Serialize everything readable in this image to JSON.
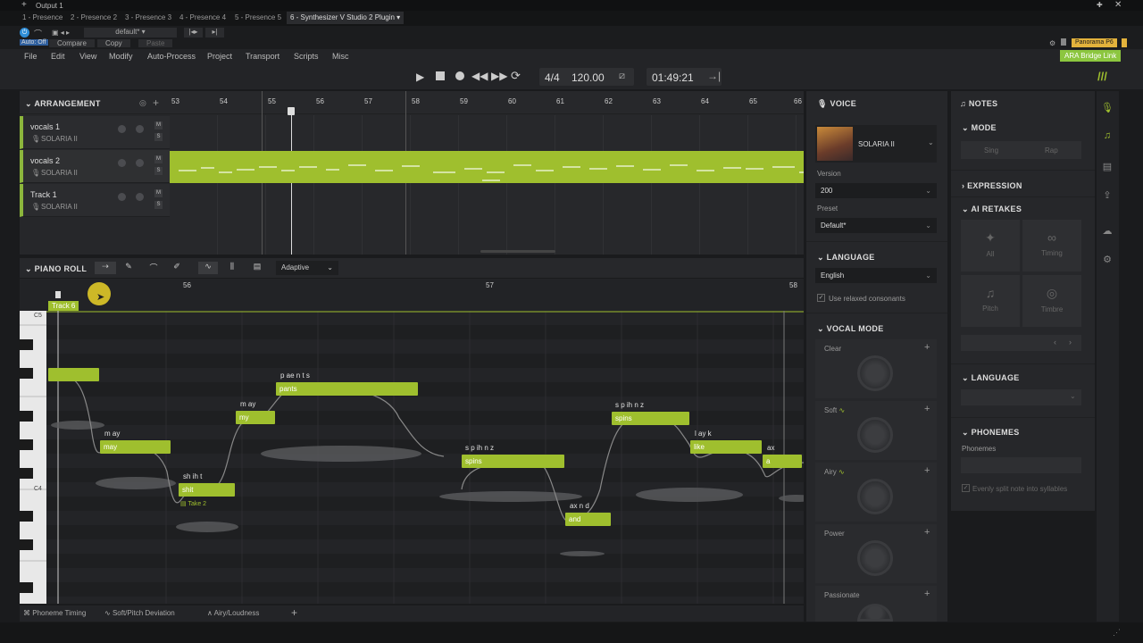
{
  "window": {
    "title": "Output 1"
  },
  "tabs": [
    "1 - Presence",
    "2 - Presence 2",
    "3 - Presence 3",
    "4 - Presence 4",
    "5 - Presence 5",
    "6 - Synthesizer V Studio 2 Plugin"
  ],
  "plugin": {
    "preset": "default*",
    "auto_off": "Auto: Off",
    "compare": "Compare",
    "copy": "Copy",
    "paste": "Paste",
    "panorama": "Panorama P6",
    "ara": "ARA Bridge Link"
  },
  "menu": [
    "File",
    "Edit",
    "View",
    "Modify",
    "Auto-Process",
    "Project",
    "Transport",
    "Scripts",
    "Misc"
  ],
  "transport": {
    "time_sig": "4/4",
    "tempo": "120.00",
    "time": "01:49:21"
  },
  "arrangement": {
    "title": "ARRANGEMENT",
    "bars": [
      "53",
      "54",
      "55",
      "56",
      "57",
      "58",
      "59",
      "60",
      "61",
      "62",
      "63",
      "64",
      "65",
      "66"
    ],
    "tracks": [
      {
        "name": "vocals 1",
        "voice": "SOLARIA II"
      },
      {
        "name": "vocals 2",
        "voice": "SOLARIA II"
      },
      {
        "name": "Track 1",
        "voice": "SOLARIA II"
      }
    ]
  },
  "pianoroll": {
    "title": "PIANO ROLL",
    "mode": "Adaptive",
    "bars": [
      "56",
      "57",
      "58"
    ],
    "track_label": "Track 6",
    "c5": "C5",
    "c4": "C4",
    "take": "Take 2",
    "notes": [
      {
        "text": "",
        "lyric": ""
      },
      {
        "text": "may",
        "lyric": "m ay"
      },
      {
        "text": "shit",
        "lyric": "sh ih t"
      },
      {
        "text": "my",
        "lyric": "m ay"
      },
      {
        "text": "pants",
        "lyric": "p ae n t s"
      },
      {
        "text": "spins",
        "lyric": "s p ih n z"
      },
      {
        "text": "and",
        "lyric": "ax n d"
      },
      {
        "text": "spins",
        "lyric": "s p ih n z"
      },
      {
        "text": "like",
        "lyric": "l ay k"
      },
      {
        "text": "a",
        "lyric": "ax"
      }
    ],
    "bottom_tabs": [
      "Phoneme Timing",
      "Soft/Pitch Deviation",
      "Airy/Loudness"
    ]
  },
  "voice": {
    "title": "VOICE",
    "name": "SOLARIA II",
    "version_label": "Version",
    "version": "200",
    "preset_label": "Preset",
    "preset": "Default*",
    "language_title": "LANGUAGE",
    "language": "English",
    "relaxed": "Use relaxed consonants",
    "vocal_mode_title": "VOCAL MODE",
    "modes": [
      "Clear",
      "Soft",
      "Airy",
      "Power",
      "Passionate"
    ]
  },
  "notes_panel": {
    "title": "NOTES",
    "mode_title": "MODE",
    "sing": "Sing",
    "rap": "Rap",
    "expression": "EXPRESSION",
    "ai_retakes": "AI RETAKES",
    "retakes": [
      "All",
      "Timing",
      "Pitch",
      "Timbre"
    ],
    "language_title": "LANGUAGE",
    "phonemes_title": "PHONEMES",
    "phonemes_label": "Phonemes",
    "split": "Evenly split note into syllables"
  },
  "colors": {
    "accent": "#9fbf2e",
    "bg": "#1a1b1d"
  }
}
